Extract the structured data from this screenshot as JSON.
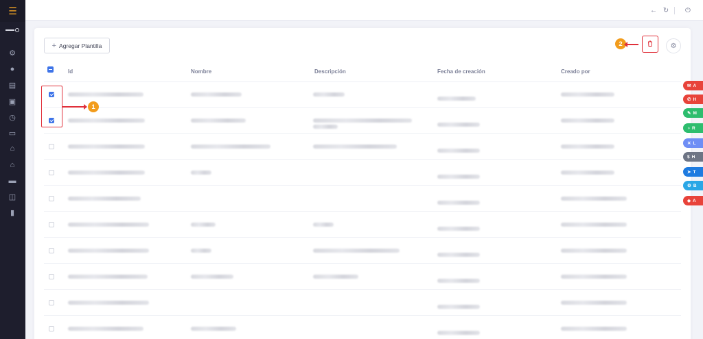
{
  "sidebar": {
    "menu_icon": "hamburger-menu-icon",
    "logo": "brand-logo",
    "items": [
      {
        "icon": "gear-icon",
        "glyph": "⚙"
      },
      {
        "icon": "user-circle-icon",
        "glyph": "●"
      },
      {
        "icon": "document-list-icon",
        "glyph": "▤"
      },
      {
        "icon": "id-card-icon",
        "glyph": "▣"
      },
      {
        "icon": "clock-icon",
        "glyph": "◷"
      },
      {
        "icon": "briefcase-icon",
        "glyph": "▭"
      },
      {
        "icon": "store-icon",
        "glyph": "⌂"
      },
      {
        "icon": "house-gear-icon",
        "glyph": "⌂"
      },
      {
        "icon": "monitor-icon",
        "glyph": "▬"
      },
      {
        "icon": "presentation-icon",
        "glyph": "◫"
      },
      {
        "icon": "bar-chart-icon",
        "glyph": "▮"
      }
    ]
  },
  "topbar": {
    "back_icon": "←",
    "refresh_icon": "↻",
    "power_icon": "⏻"
  },
  "toolbar": {
    "add_label": "Agregar Plantilla",
    "add_plus": "+",
    "delete_icon": "🗑",
    "settings_icon": "⚙"
  },
  "table": {
    "columns": [
      "Id",
      "Nombre",
      "Descripción",
      "Fecha de creación",
      "Creado por"
    ],
    "rows": [
      {
        "checked": true
      },
      {
        "checked": true
      },
      {
        "checked": false
      },
      {
        "checked": false
      },
      {
        "checked": false
      },
      {
        "checked": false
      },
      {
        "checked": false
      },
      {
        "checked": false
      },
      {
        "checked": false
      },
      {
        "checked": false
      }
    ]
  },
  "annotations": {
    "badge_1": "1",
    "badge_2": "2"
  },
  "floating_tabs": [
    {
      "label": "A",
      "icon": "✉",
      "color": "#e8433a"
    },
    {
      "label": "H",
      "icon": "✆",
      "color": "#e8433a"
    },
    {
      "label": "M",
      "icon": "✎",
      "color": "#2dbd6e"
    },
    {
      "label": "R",
      "icon": "◑",
      "color": "#2dbd6e"
    },
    {
      "label": "L",
      "icon": "✕",
      "color": "#6f8ef5"
    },
    {
      "label": "H",
      "icon": "$",
      "color": "#6e7585"
    },
    {
      "label": "T",
      "icon": "➤",
      "color": "#1e7be0"
    },
    {
      "label": "B",
      "icon": "⚙",
      "color": "#2aa7e6"
    },
    {
      "label": "A",
      "icon": "◆",
      "color": "#e8433a"
    }
  ],
  "colors": {
    "accent": "#3e74e8",
    "annotation": "#e0303a",
    "badge": "#f29c1c",
    "sidebar": "#1e1e2d"
  }
}
